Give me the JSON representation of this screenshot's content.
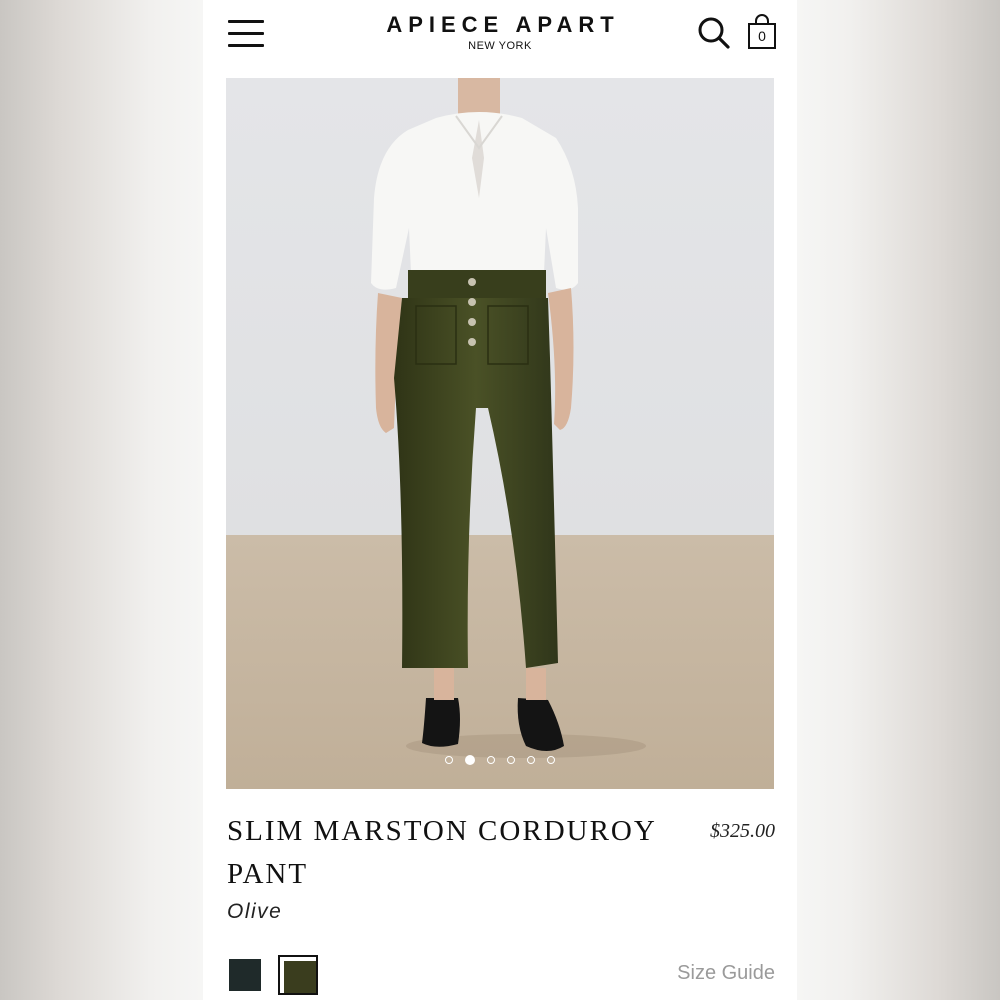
{
  "header": {
    "brand_name": "APIECE APART",
    "brand_sub": "NEW YORK",
    "bag_count": "0",
    "icons": [
      "menu-icon",
      "search-icon",
      "shopping-bag-icon"
    ]
  },
  "gallery": {
    "image_subject": "model-photo",
    "dot_count": 6,
    "active_index": 1
  },
  "product": {
    "title": "SLIM MARSTON CORDUROY PANT",
    "price": "$325.00",
    "color_name": "Olive",
    "swatches": [
      {
        "name": "dark-teal",
        "color": "#1f2a2a",
        "selected": false
      },
      {
        "name": "olive",
        "color": "#3a3d1e",
        "selected": true
      }
    ],
    "size_guide_label": "Size Guide"
  },
  "colors": {
    "background": "#ffffff",
    "text": "#111111",
    "muted": "#9a9a9a"
  }
}
